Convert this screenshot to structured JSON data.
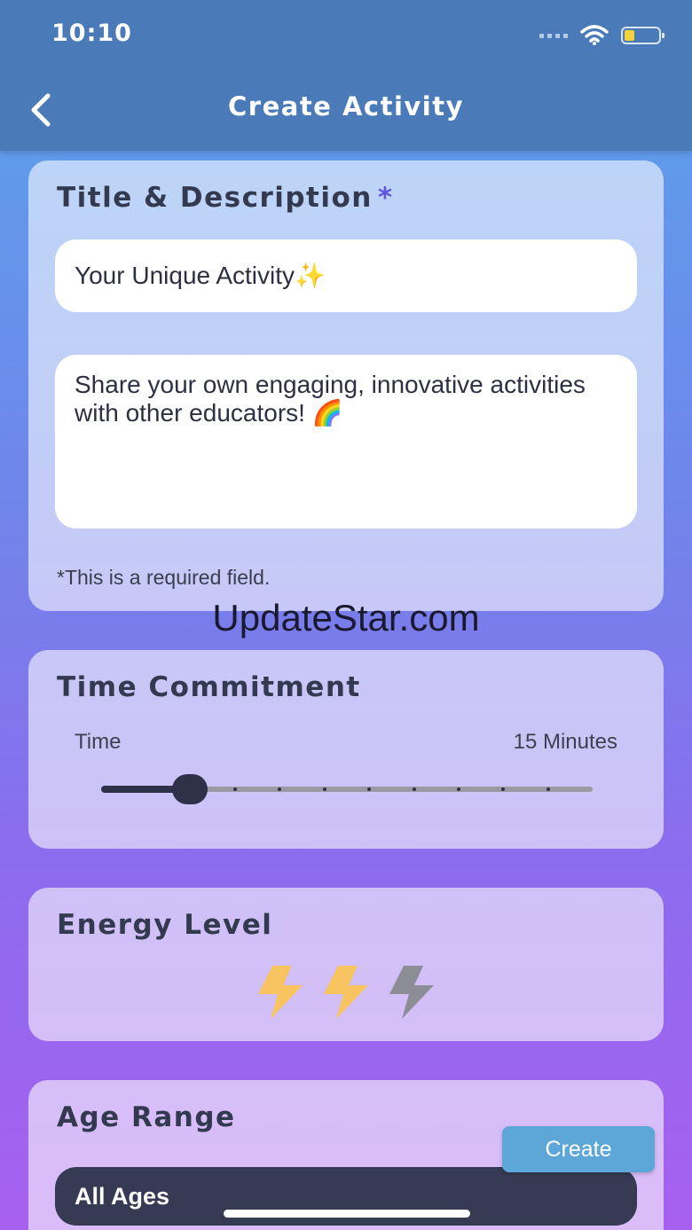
{
  "status_bar": {
    "time": "10:10"
  },
  "header": {
    "title": "Create Activity"
  },
  "title_card": {
    "heading": "Title & Description",
    "required_mark": "*",
    "title_value": "Your Unique Activity✨",
    "description_value": "Share your own engaging, innovative activities with other educators! 🌈",
    "required_note": "*This is a required field."
  },
  "watermark": "UpdateStar.com",
  "time_card": {
    "heading": "Time Commitment",
    "slider_label": "Time",
    "slider_value_text": "15 Minutes",
    "slider_level": 0.18,
    "tick_count": 12
  },
  "energy_card": {
    "heading": "Energy Level",
    "rating": 2,
    "max_rating": 3,
    "active_color": "#f7c460",
    "inactive_color": "#8d8e95"
  },
  "age_card": {
    "heading": "Age Range",
    "selected": "All Ages"
  },
  "actions": {
    "create_label": "Create"
  },
  "colors": {
    "header": "#4b7ab9",
    "accent": "#5f55e0",
    "button": "#5da6d8",
    "dark": "#2e3148"
  }
}
